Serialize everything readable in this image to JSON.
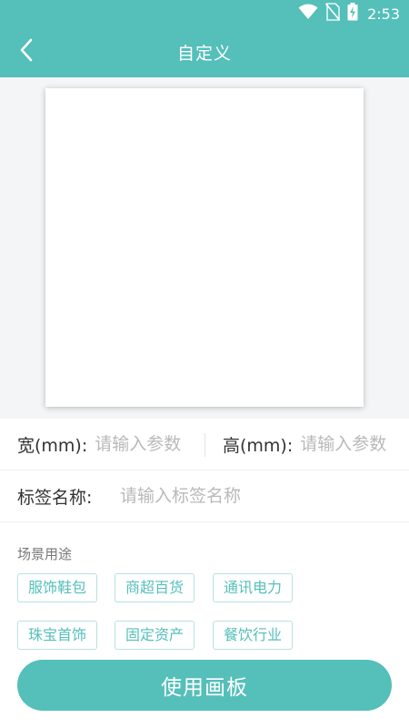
{
  "status_bar": {
    "time": "2:53",
    "icons": [
      "wifi-icon",
      "no-sim-icon",
      "battery-charging-icon"
    ]
  },
  "header": {
    "title": "自定义",
    "back_icon": "back-arrow-icon"
  },
  "form": {
    "width_label": "宽(mm):",
    "width_placeholder": "请输入参数",
    "height_label": "高(mm):",
    "height_placeholder": "请输入参数",
    "name_label": "标签名称:",
    "name_placeholder": "请输入标签名称"
  },
  "scene": {
    "title": "场景用途",
    "tags": [
      "服饰鞋包",
      "商超百货",
      "通讯电力",
      "珠宝首饰",
      "固定资产",
      "餐饮行业"
    ]
  },
  "submit_label": "使用画板",
  "colors": {
    "primary": "#55bfba",
    "tag_border": "#b9e2e0",
    "background": "#f4f5f7",
    "placeholder": "#b9b9b9"
  }
}
